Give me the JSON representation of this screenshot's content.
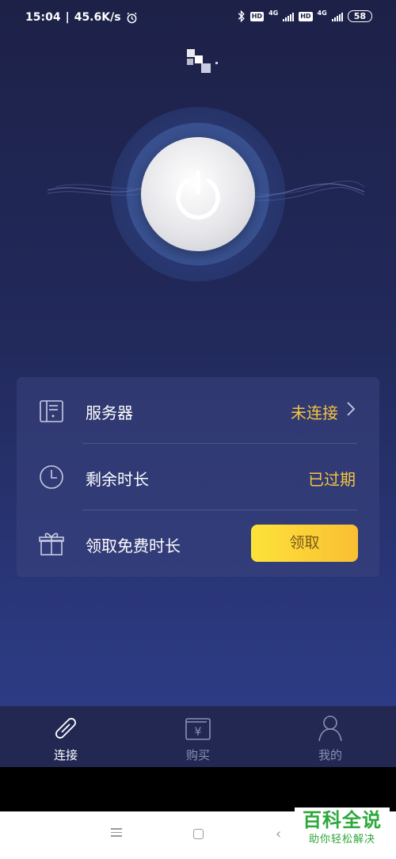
{
  "status_bar": {
    "time": "15:04",
    "separator": "|",
    "speed": "45.6K/s",
    "hd1": "HD",
    "net1": "4G",
    "hd2": "HD",
    "net2": "4G",
    "battery": "58"
  },
  "power": {
    "state": "disconnected",
    "icon": "power-icon"
  },
  "server_row": {
    "icon": "server-icon",
    "label": "服务器",
    "value": "未连接"
  },
  "remaining_row": {
    "icon": "clock-icon",
    "label": "剩余时长",
    "value": "已过期"
  },
  "free_time_row": {
    "icon": "gift-icon",
    "label": "领取免费时长",
    "button_label": "领取"
  },
  "tabs": [
    {
      "label": "连接",
      "icon": "link-icon",
      "active": true
    },
    {
      "label": "购买",
      "icon": "wallet-icon",
      "active": false
    },
    {
      "label": "我的",
      "icon": "user-icon",
      "active": false
    }
  ],
  "watermark": {
    "title": "百科全说",
    "subtitle": "助你轻松解决"
  },
  "colors": {
    "accent": "#f6c53f",
    "background_top": "#1d2148",
    "background_bottom": "#2e3d88",
    "button_gradient_start": "#fde23a",
    "button_gradient_end": "#f9bf33",
    "watermark_green": "#2da83b"
  }
}
